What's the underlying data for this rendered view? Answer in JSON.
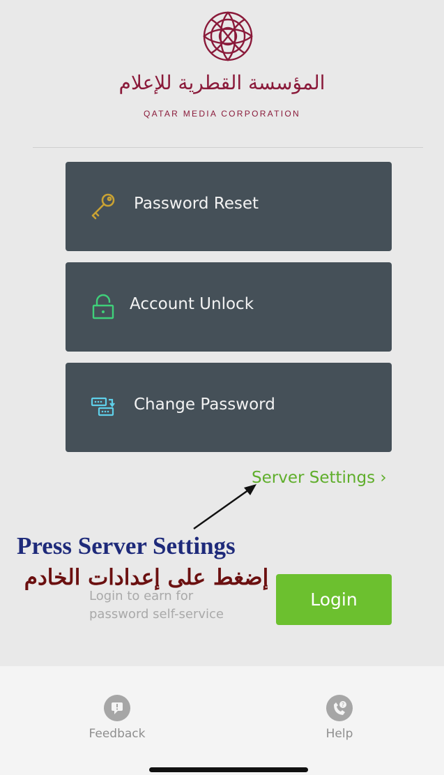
{
  "header": {
    "logo_arabic": "المؤسسة القطرية للإعلام",
    "logo_english": "QATAR MEDIA CORPORATION"
  },
  "menu": {
    "password_reset": "Password Reset",
    "account_unlock": "Account Unlock",
    "change_password": "Change Password"
  },
  "server_settings": "Server Settings ›",
  "annotation": {
    "english": "Press Server Settings",
    "arabic": "إضغط على إعدادات الخادم"
  },
  "login": {
    "hint": "Login to earn for password self-service",
    "button": "Login"
  },
  "bottom_nav": {
    "feedback": "Feedback",
    "help": "Help"
  },
  "colors": {
    "brand": "#8a1a3a",
    "menu_bg": "#455058",
    "accent_green": "#6cc02f",
    "link_green": "#5fae2b"
  },
  "icons": {
    "password_reset": "key-icon",
    "account_unlock": "lock-icon",
    "change_password": "password-change-icon",
    "feedback": "feedback-icon",
    "help": "help-phone-icon"
  }
}
